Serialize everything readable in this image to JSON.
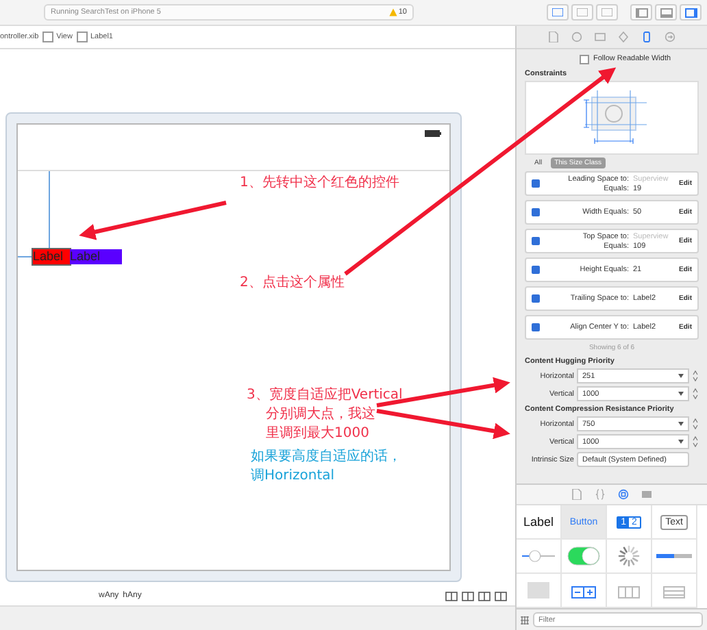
{
  "toolbar": {
    "status": "Running SearchTest on iPhone 5",
    "warning_count": "10",
    "panel_toggles": [
      {
        "selected": false
      },
      {
        "selected": false
      },
      {
        "selected": true
      }
    ]
  },
  "breadcrumb": [
    {
      "label": "ontroller.xib",
      "kind": "file"
    },
    {
      "label": "View",
      "kind": "view"
    },
    {
      "label": "Label1",
      "kind": "label"
    }
  ],
  "canvas": {
    "labels": [
      {
        "text": "Label",
        "color": "#ff0000",
        "selected": true
      },
      {
        "text": "Label",
        "color": "#5a00ff",
        "selected": false
      }
    ],
    "size_class": [
      "wAny",
      "hAny"
    ]
  },
  "annotations": [
    {
      "kind": "red",
      "lines": [
        "1、先转中这个红色的控件"
      ]
    },
    {
      "kind": "red",
      "lines": [
        "2、点击这个属性"
      ]
    },
    {
      "kind": "red",
      "lines": [
        "3、宽度自适应把Vertical",
        "分别调大点，我这",
        "里调到最大1000"
      ]
    },
    {
      "kind": "blue",
      "lines": [
        "如果要高度自适应的话，",
        "调Horizontal"
      ]
    }
  ],
  "inspector": {
    "tabs": [
      {
        "kind": "file",
        "selected": false
      },
      {
        "kind": "help",
        "selected": false
      },
      {
        "kind": "identity",
        "selected": false
      },
      {
        "kind": "attributes",
        "selected": false
      },
      {
        "kind": "size",
        "selected": true
      },
      {
        "kind": "connections",
        "selected": false
      }
    ],
    "follow_readable_width": {
      "label": "Follow Readable Width",
      "checked": false
    },
    "constraints": {
      "title": "Constraints",
      "scopes": [
        {
          "label": "All",
          "selected": false
        },
        {
          "label": "This Size Class",
          "selected": true
        }
      ],
      "rows": [
        {
          "lines": [
            {
              "label": "Leading Space to:",
              "value": "Superview",
              "muted": true
            },
            {
              "label": "Equals:",
              "value": "19",
              "muted": false
            }
          ],
          "action": "Edit"
        },
        {
          "lines": [
            {
              "label": "Width Equals:",
              "value": "50",
              "muted": false
            }
          ],
          "action": "Edit"
        },
        {
          "lines": [
            {
              "label": "Top Space to:",
              "value": "Superview",
              "muted": true
            },
            {
              "label": "Equals:",
              "value": "109",
              "muted": false
            }
          ],
          "action": "Edit"
        },
        {
          "lines": [
            {
              "label": "Height Equals:",
              "value": "21",
              "muted": false
            }
          ],
          "action": "Edit"
        },
        {
          "lines": [
            {
              "label": "Trailing Space to:",
              "value": "Label2",
              "muted": false
            }
          ],
          "action": "Edit"
        },
        {
          "lines": [
            {
              "label": "Align Center Y to:",
              "value": "Label2",
              "muted": false
            }
          ],
          "action": "Edit"
        }
      ],
      "showing": "Showing 6 of 6"
    },
    "priorities": [
      {
        "title": "Content Hugging Priority",
        "rows": [
          {
            "label": "Horizontal",
            "value": "251"
          },
          {
            "label": "Vertical",
            "value": "1000"
          }
        ]
      },
      {
        "title": "Content Compression Resistance Priority",
        "rows": [
          {
            "label": "Horizontal",
            "value": "750"
          },
          {
            "label": "Vertical",
            "value": "1000"
          }
        ]
      }
    ],
    "intrinsic_size": {
      "label": "Intrinsic Size",
      "value": "Default (System Defined)"
    }
  },
  "library": {
    "tabs": [
      {
        "kind": "file",
        "selected": false
      },
      {
        "kind": "braces",
        "selected": false
      },
      {
        "kind": "object",
        "selected": true
      },
      {
        "kind": "media",
        "selected": false
      }
    ],
    "items": [
      {
        "kind": "label",
        "text": "Label",
        "selected": false
      },
      {
        "kind": "button",
        "text": "Button",
        "selected": true
      },
      {
        "kind": "segmented",
        "segments": [
          "1",
          "2"
        ],
        "selected": false
      },
      {
        "kind": "textfield",
        "text": "Text",
        "selected": false
      },
      {
        "kind": "slider",
        "level": 0.35,
        "selected": false
      },
      {
        "kind": "switch",
        "on": true,
        "selected": false
      },
      {
        "kind": "spinner",
        "selected": false
      },
      {
        "kind": "progress",
        "level": 0.5,
        "selected": false
      },
      {
        "kind": "view",
        "selected": false
      },
      {
        "kind": "stepper",
        "selected": false
      },
      {
        "kind": "columns",
        "selected": false
      },
      {
        "kind": "rows",
        "selected": false
      }
    ],
    "filter": {
      "placeholder": "Filter"
    }
  }
}
